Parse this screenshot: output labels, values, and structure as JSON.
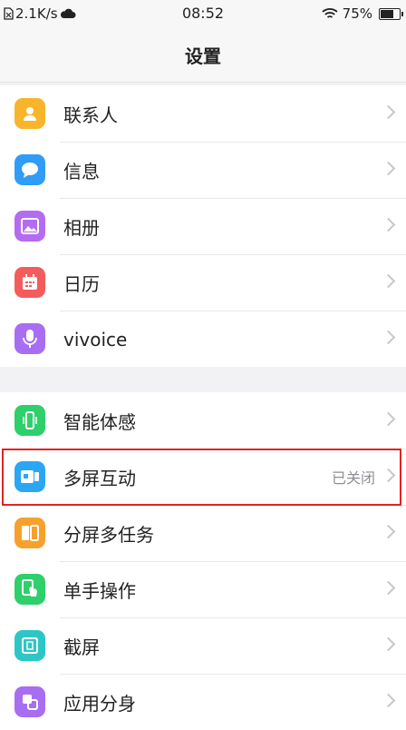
{
  "status_bar": {
    "net_speed": "2.1K/s",
    "time": "08:52",
    "battery": "75%",
    "battery_level_pct": 75
  },
  "nav": {
    "title": "设置"
  },
  "groups": [
    {
      "items": [
        {
          "label": "联系人",
          "icon": "contacts-icon",
          "color": "#f7b52c"
        },
        {
          "label": "信息",
          "icon": "messages-icon",
          "color": "#2f9cf6"
        },
        {
          "label": "相册",
          "icon": "gallery-icon",
          "color": "#b46bf0"
        },
        {
          "label": "日历",
          "icon": "calendar-icon",
          "color": "#f45c5c"
        },
        {
          "label": "vivoice",
          "icon": "microphone-icon",
          "color": "#a86ef2"
        }
      ]
    },
    {
      "items": [
        {
          "label": "智能体感",
          "icon": "motion-phone-icon",
          "color": "#2fcf6b"
        },
        {
          "label": "多屏互动",
          "icon": "screen-cast-icon",
          "color": "#2aa6f2",
          "value": "已关闭"
        },
        {
          "label": "分屏多任务",
          "icon": "split-screen-icon",
          "color": "#f7a12c"
        },
        {
          "label": "单手操作",
          "icon": "one-hand-icon",
          "color": "#2fcf6b"
        },
        {
          "label": "截屏",
          "icon": "screenshot-icon",
          "color": "#2dc6c6"
        },
        {
          "label": "应用分身",
          "icon": "app-clone-icon",
          "color": "#a86ef2"
        }
      ]
    }
  ]
}
